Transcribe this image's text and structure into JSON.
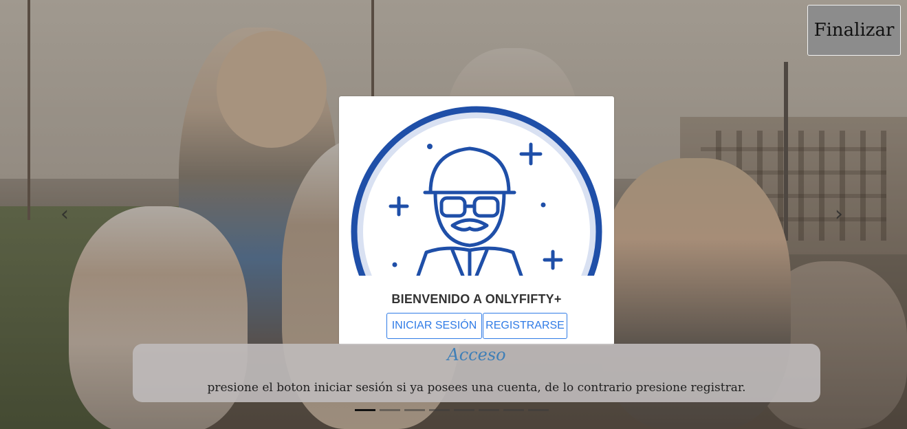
{
  "finalize_button": {
    "label": "Finalizar"
  },
  "carousel": {
    "prev_icon": "chevron-left-icon",
    "next_icon": "chevron-right-icon",
    "prev_glyph": "‹",
    "next_glyph": "›",
    "slide_count": 8,
    "active_index": 0
  },
  "card": {
    "title": "BIENVENIDO A ONLYFIFTY+",
    "login_label": "INICIAR SESIÓN",
    "register_label": "REGISTRARSE",
    "accent_color": "#2f7be6",
    "logo_icon": "elderly-man-avatar-icon"
  },
  "caption": {
    "title": "Acceso",
    "text": "presione el boton iniciar sesión si ya posees una cuenta, de lo contrario presione registrar.",
    "title_color": "#3f7fb7"
  }
}
